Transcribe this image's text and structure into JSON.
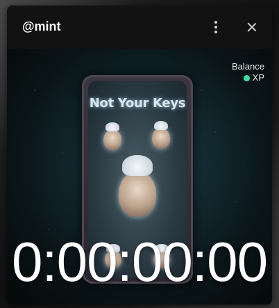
{
  "header": {
    "title": "@mint",
    "menu_icon": "kebab-vertical-icon",
    "close_icon": "close-icon"
  },
  "balance": {
    "label": "Balance",
    "currency": "XP",
    "dot_color": "#3ee0a8"
  },
  "media": {
    "card_title": "Not Your Keys"
  },
  "timer": {
    "value": "0:00:00:00"
  }
}
